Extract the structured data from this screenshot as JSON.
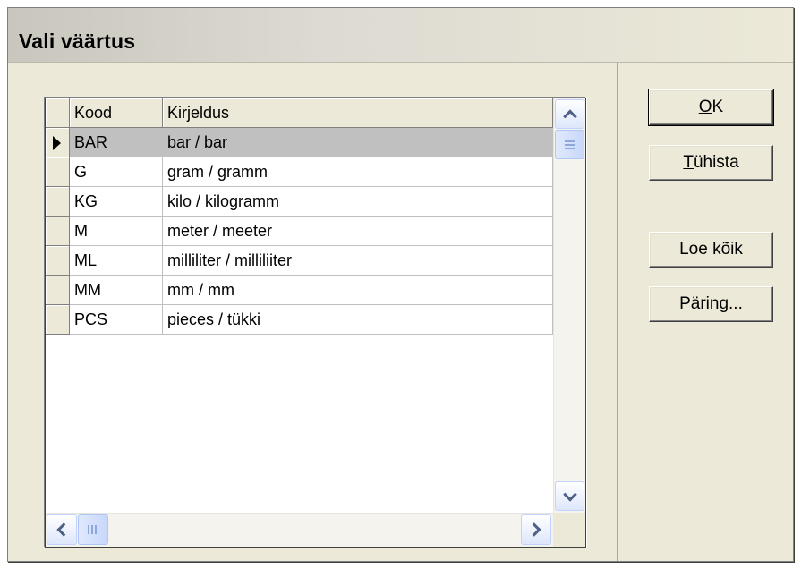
{
  "window": {
    "title": "Vali väärtus"
  },
  "grid": {
    "columns": [
      "Kood",
      "Kirjeldus"
    ],
    "rows": [
      {
        "kood": "BAR",
        "kirjeldus": "bar / bar",
        "selected": true
      },
      {
        "kood": "G",
        "kirjeldus": "gram / gramm",
        "selected": false
      },
      {
        "kood": "KG",
        "kirjeldus": "kilo / kilogramm",
        "selected": false
      },
      {
        "kood": "M",
        "kirjeldus": "meter / meeter",
        "selected": false
      },
      {
        "kood": "ML",
        "kirjeldus": "milliliter / milliliiter",
        "selected": false
      },
      {
        "kood": "MM",
        "kirjeldus": "mm / mm",
        "selected": false
      },
      {
        "kood": "PCS",
        "kirjeldus": "pieces / tükki",
        "selected": false
      }
    ]
  },
  "buttons": {
    "ok": {
      "label": "OK",
      "accel": "O"
    },
    "cancel": {
      "label": "Tühista",
      "accel": "T"
    },
    "load_all": {
      "label": "Loe kõik"
    },
    "query": {
      "label": "Päring..."
    }
  },
  "icons": {
    "row_indicator": "triangle-right-icon",
    "scroll_up": "chevron-up-icon",
    "scroll_down": "chevron-down-icon",
    "scroll_left": "chevron-left-icon",
    "scroll_right": "chevron-right-icon"
  },
  "colors": {
    "dialog_bg": "#ece9d8",
    "selected_row": "#c0c0c0"
  }
}
